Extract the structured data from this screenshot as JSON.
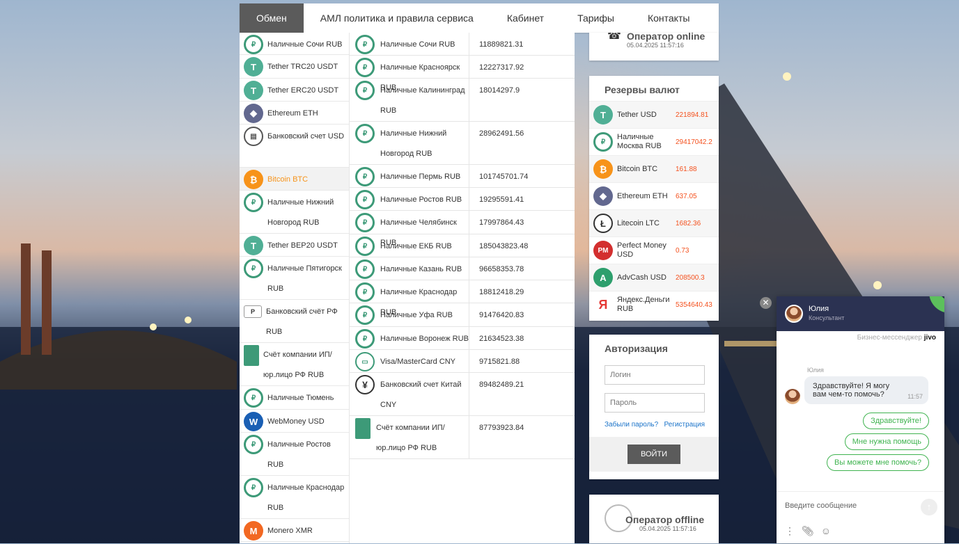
{
  "nav": [
    "Обмен",
    "АМЛ политика и правила сервиса",
    "Кабинет",
    "Тарифы",
    "Контакты"
  ],
  "left_list": [
    {
      "name": "Наличные Сочи RUB",
      "icon": "cash-icon",
      "h": 32
    },
    {
      "name": "Tether TRC20 USDT",
      "icon": "tether-icon",
      "h": 34
    },
    {
      "name": "Tether ERC20 USDT",
      "icon": "tether-icon",
      "h": 33
    },
    {
      "name": "Ethereum ETH",
      "icon": "ethereum-icon",
      "h": 33
    },
    {
      "name": "Банковский счет USD",
      "icon": "bank-icon",
      "h": 62
    },
    {
      "name": "Bitcoin BTC",
      "icon": "bitcoin-icon",
      "h": 33,
      "selected": true
    },
    {
      "name": "Наличные Нижний Новгород RUB",
      "icon": "cash-icon",
      "h": 62
    },
    {
      "name": "Tether BEP20 USDT",
      "icon": "tether-icon",
      "h": 33
    },
    {
      "name": "Наличные Пятигорск RUB",
      "icon": "cash-icon",
      "h": 62
    },
    {
      "name": "Банковский счёт РФ RUB",
      "icon": "bank-rf-icon",
      "h": 62
    },
    {
      "name": "Счёт компании ИП/ юр.лицо РФ RUB",
      "icon": "company-account-icon",
      "h": 62
    },
    {
      "name": "Наличные Тюмень",
      "icon": "cash-icon",
      "h": 34
    },
    {
      "name": "WebMoney USD",
      "icon": "webmoney-icon",
      "h": 33
    },
    {
      "name": "Наличные Ростов RUB",
      "icon": "cash-icon",
      "h": 62
    },
    {
      "name": "Наличные Краснодар RUB",
      "icon": "cash-icon",
      "h": 62
    },
    {
      "name": "Monero XMR",
      "icon": "monero-icon",
      "h": 33
    }
  ],
  "mid_table": [
    {
      "name": "Наличные Сочи RUB",
      "value": "11889821.31",
      "icon": "cash-icon",
      "h": 33
    },
    {
      "name": "Наличные Красноярск RUB",
      "value": "12227317.92",
      "icon": "cash-icon",
      "h": 33
    },
    {
      "name": "Наличные Калининград RUB",
      "value": "18014297.9",
      "icon": "cash-icon",
      "h": 62
    },
    {
      "name": "Наличные Нижний Новгород RUB",
      "value": "28962491.56",
      "icon": "cash-icon",
      "h": 62
    },
    {
      "name": "Наличные Пермь RUB",
      "value": "101745701.74",
      "icon": "cash-icon",
      "h": 33
    },
    {
      "name": "Наличные Ростов RUB",
      "value": "19295591.41",
      "icon": "cash-icon",
      "h": 33
    },
    {
      "name": "Наличные Челябинск RUB",
      "value": "17997864.43",
      "icon": "cash-icon",
      "h": 34
    },
    {
      "name": "Наличные ЕКБ RUB",
      "value": "185043823.48",
      "icon": "cash-icon",
      "h": 33
    },
    {
      "name": "Наличные Казань RUB",
      "value": "96658353.78",
      "icon": "cash-icon",
      "h": 33
    },
    {
      "name": "Наличные Краснодар RUB",
      "value": "18812418.29",
      "icon": "cash-icon",
      "h": 33
    },
    {
      "name": "Наличные Уфа RUB",
      "value": "91476420.83",
      "icon": "cash-icon",
      "h": 34
    },
    {
      "name": "Наличные Воронеж RUB",
      "value": "21634523.38",
      "icon": "cash-icon",
      "h": 33
    },
    {
      "name": "Visa/MasterCard CNY",
      "value": "9715821.88",
      "icon": "card-icon",
      "h": 33
    },
    {
      "name": "Банковский счет Китай CNY",
      "value": "89482489.21",
      "icon": "yuan-icon",
      "h": 62
    },
    {
      "name": "Счёт компании ИП/ юр.лицо РФ RUB",
      "value": "87793923.84",
      "icon": "company-account-icon",
      "h": 62
    }
  ],
  "operator_top": {
    "title": "Оператор online",
    "date": "05.04.2025 11:57:16"
  },
  "reserves": {
    "title": "Резервы валют",
    "items": [
      {
        "name": "Tether USD",
        "value": "221894.81",
        "icon": "tether-icon"
      },
      {
        "name": "Наличные Москва RUB",
        "value": "29417042.2",
        "icon": "cash-icon"
      },
      {
        "name": "Bitcoin BTC",
        "value": "161.88",
        "icon": "bitcoin-icon"
      },
      {
        "name": "Ethereum ETH",
        "value": "637.05",
        "icon": "ethereum-icon"
      },
      {
        "name": "Litecoin LTC",
        "value": "1682.36",
        "icon": "litecoin-icon"
      },
      {
        "name": "Perfect Money USD",
        "value": "0.73",
        "icon": "perfect-money-icon"
      },
      {
        "name": "AdvCash USD",
        "value": "208500.3",
        "icon": "advcash-icon"
      },
      {
        "name": "Яндекс.Деньги RUB",
        "value": "5354640.43",
        "icon": "yandex-icon"
      }
    ]
  },
  "auth": {
    "title": "Авторизация",
    "login_placeholder": "Логин",
    "password_placeholder": "Пароль",
    "forgot": "Забыли пароль?",
    "register": "Регистрация",
    "submit": "ВОЙТИ"
  },
  "operator_bottom": {
    "title": "Оператор offline",
    "date": "05.04.2025 11:57:16"
  },
  "chat": {
    "agent_name": "Юлия",
    "agent_role": "Консультант",
    "brand_prefix": "Бизнес-мессенджер",
    "brand": "jivo",
    "msg_author": "Юлия",
    "msg_text": "Здравствуйте! Я могу вам чем-то помочь?",
    "msg_time": "11:57",
    "quick_replies": [
      "Здравствуйте!",
      "Мне нужна помощь",
      "Вы можете мне помочь?"
    ],
    "input_placeholder": "Введите сообщение"
  }
}
